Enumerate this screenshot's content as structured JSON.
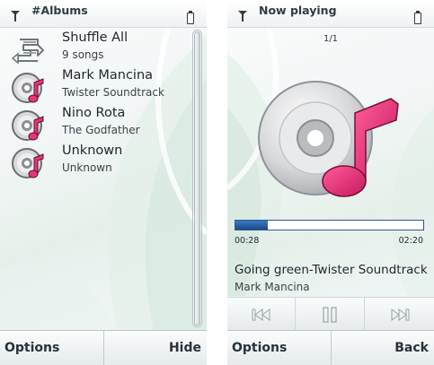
{
  "left_screen": {
    "title": "#Albums",
    "items": [
      {
        "title": "Shuffle All",
        "subtitle": "9 songs",
        "icon": "shuffle-icon"
      },
      {
        "title": "Mark Mancina",
        "subtitle": "Twister Soundtrack",
        "icon": "album-music-icon"
      },
      {
        "title": "Nino Rota",
        "subtitle": "The Godfather",
        "icon": "album-music-icon"
      },
      {
        "title": "Unknown",
        "subtitle": "Unknown",
        "icon": "album-music-icon"
      }
    ],
    "softkeys": {
      "left": "Options",
      "right": "Hide"
    }
  },
  "right_screen": {
    "title": "Now playing",
    "track_position": "1/1",
    "elapsed": "00:28",
    "duration": "02:20",
    "progress_fraction": 0.17,
    "song_title": "Going green-Twister Soundtrack",
    "artist": "Mark Mancina",
    "controls": [
      "previous-icon",
      "pause-icon",
      "next-icon"
    ],
    "softkeys": {
      "left": "Options",
      "right": "Back"
    }
  },
  "colors": {
    "accent_pink": "#e8347a",
    "progress_blue": "#1f56a6",
    "text_dark": "#1f262c"
  }
}
